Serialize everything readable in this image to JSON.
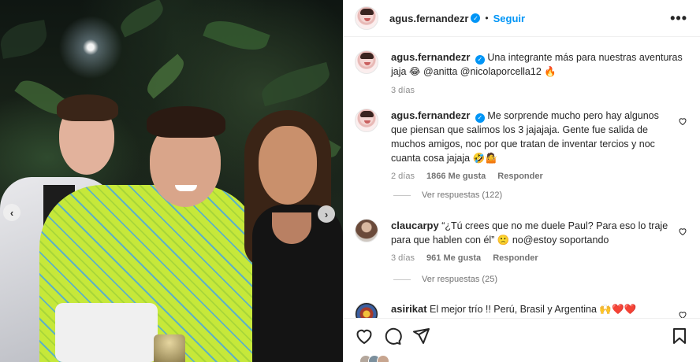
{
  "post": {
    "author": "agus.fernandezr",
    "follow_label": "Seguir",
    "more_label": "•••",
    "dot": "•",
    "caption": {
      "user": "agus.fernandezr",
      "text": "Una integrante más para nuestras aventuras jaja 😂 @anitta @nicolaporcella12 🔥",
      "time": "3 días"
    }
  },
  "comments": [
    {
      "user": "agus.fernandezr",
      "text": "Me sorprende mucho pero hay algunos que piensan que salimos los 3 jajajaja. Gente fue salida de muchos amigos, noc por que tratan de inventar tercios y noc cuanta cosa jajaja 🤣🤷",
      "time": "2 días",
      "likes": "1866 Me gusta",
      "reply": "Responder",
      "view_replies": "Ver respuestas (122)"
    },
    {
      "user": "claucarpy",
      "text": "“¿Tú crees que no me duele Paul? Para eso lo traje para que hablen con él” 🙁 no@estoy soportando",
      "time": "3 días",
      "likes": "961 Me gusta",
      "reply": "Responder",
      "view_replies": "Ver respuestas (25)"
    },
    {
      "user": "asirikat",
      "text": "El mejor trío !! Perú, Brasil y Argentina 🙌❤️❤️"
    }
  ],
  "icons": {
    "verified": "✓",
    "prev": "‹",
    "next": "›"
  },
  "colors": {
    "accent": "#0095f6",
    "sweater": "#c6e83a"
  }
}
